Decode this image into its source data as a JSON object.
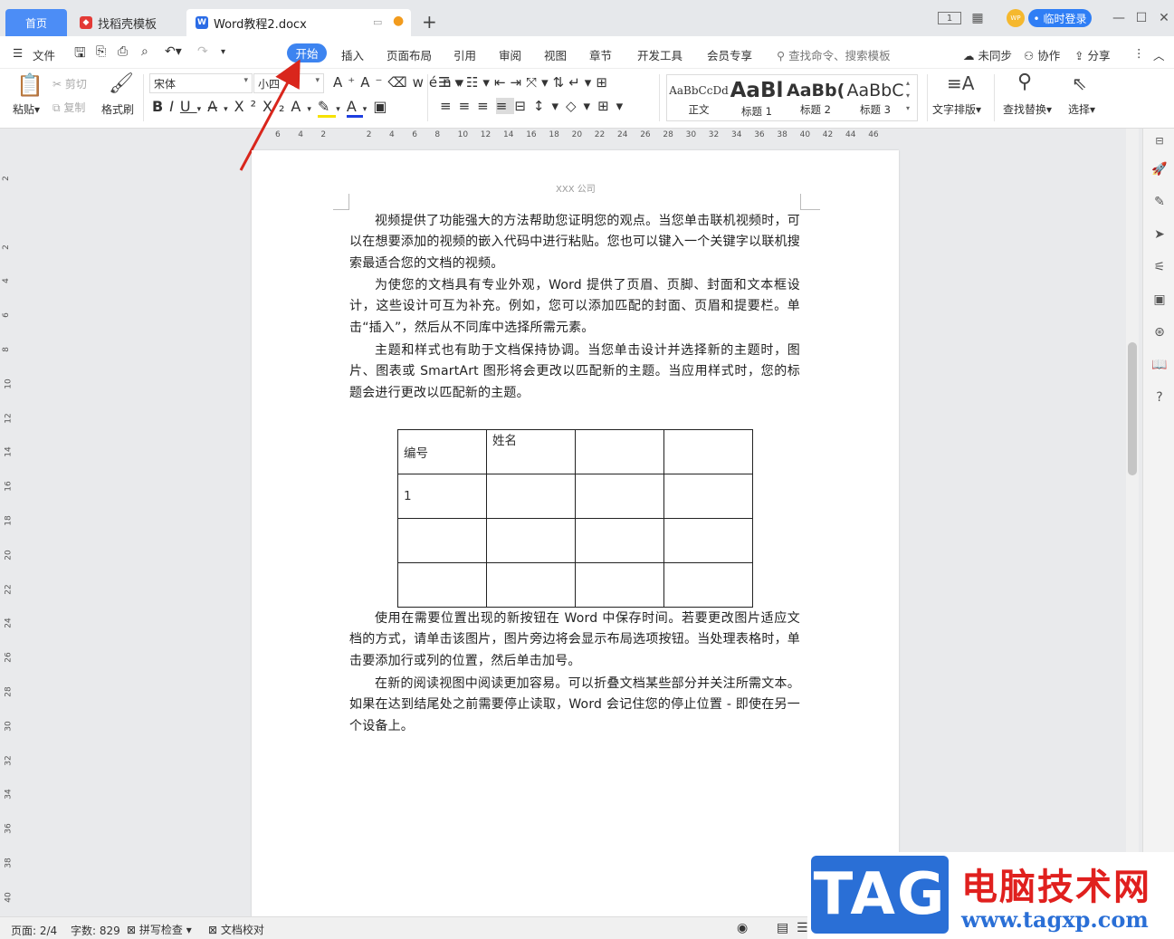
{
  "titlebar": {
    "home_tab": "首页",
    "template_tab": "找稻壳模板",
    "doc_tab": "Word教程2.docx",
    "new_tab": "+",
    "login": "• 临时登录",
    "avatar_text": "WP"
  },
  "menu": {
    "file": "文件",
    "items": [
      "开始",
      "插入",
      "页面布局",
      "引用",
      "审阅",
      "视图",
      "章节",
      "开发工具",
      "会员专享"
    ],
    "search_placeholder": "查找命令、搜索模板",
    "sync": "未同步",
    "collab": "协作",
    "share": "分享"
  },
  "ribbon": {
    "paste": "粘贴",
    "cut": "剪切",
    "copy": "复制",
    "format_painter": "格式刷",
    "font_name": "宋体",
    "font_size": "小四",
    "styles": [
      {
        "preview": "AaBbCcDd",
        "name": "正文"
      },
      {
        "preview": "AaBl",
        "name": "标题 1"
      },
      {
        "preview": "AaBb(",
        "name": "标题 2"
      },
      {
        "preview": "AaBbC",
        "name": "标题 3"
      }
    ],
    "text_layout": "文字排版",
    "find_replace": "查找替换",
    "select": "选择"
  },
  "ruler": {
    "h_ticks": [
      "6",
      "4",
      "2",
      "",
      "2",
      "4",
      "6",
      "8",
      "10",
      "12",
      "14",
      "16",
      "18",
      "20",
      "22",
      "24",
      "26",
      "28",
      "30",
      "32",
      "34",
      "36",
      "38",
      "40",
      "42",
      "44",
      "46"
    ],
    "v_ticks": [
      "2",
      "",
      "2",
      "4",
      "6",
      "8",
      "10",
      "12",
      "14",
      "16",
      "18",
      "20",
      "22",
      "24",
      "26",
      "28",
      "30",
      "32",
      "34",
      "36",
      "38",
      "40"
    ]
  },
  "document": {
    "header": "XXX 公司",
    "paragraphs": [
      "视频提供了功能强大的方法帮助您证明您的观点。当您单击联机视频时，可以在想要添加的视频的嵌入代码中进行粘贴。您也可以键入一个关键字以联机搜索最适合您的文档的视频。",
      "为使您的文档具有专业外观，Word 提供了页眉、页脚、封面和文本框设计，这些设计可互为补充。例如，您可以添加匹配的封面、页眉和提要栏。单击“插入”，然后从不同库中选择所需元素。",
      "主题和样式也有助于文档保持协调。当您单击设计并选择新的主题时，图片、图表或 SmartArt 图形将会更改以匹配新的主题。当应用样式时，您的标题会进行更改以匹配新的主题。"
    ],
    "table": [
      [
        "编号",
        "姓名",
        "",
        ""
      ],
      [
        "1",
        "",
        "",
        ""
      ],
      [
        "",
        "",
        "",
        ""
      ],
      [
        "",
        "",
        "",
        ""
      ]
    ],
    "paragraphs_after": [
      "使用在需要位置出现的新按钮在 Word 中保存时间。若要更改图片适应文档的方式，请单击该图片，图片旁边将会显示布局选项按钮。当处理表格时，单击要添加行或列的位置，然后单击加号。",
      "在新的阅读视图中阅读更加容易。可以折叠文档某些部分并关注所需文本。如果在达到结尾处之前需要停止读取，Word 会记住您的停止位置 - 即使在另一个设备上。"
    ]
  },
  "statusbar": {
    "page": "页面: 2/4",
    "words": "字数: 829",
    "spell": "拼写检查",
    "proof": "文档校对"
  },
  "watermark": {
    "tag": "TAG",
    "cn": "电脑技术网",
    "url": "www.tagxp.com"
  },
  "colors": {
    "accent": "#3d84f0",
    "arrow": "#d9261c",
    "watermark_red": "#e0201e",
    "watermark_blue": "#2a6fd6"
  }
}
